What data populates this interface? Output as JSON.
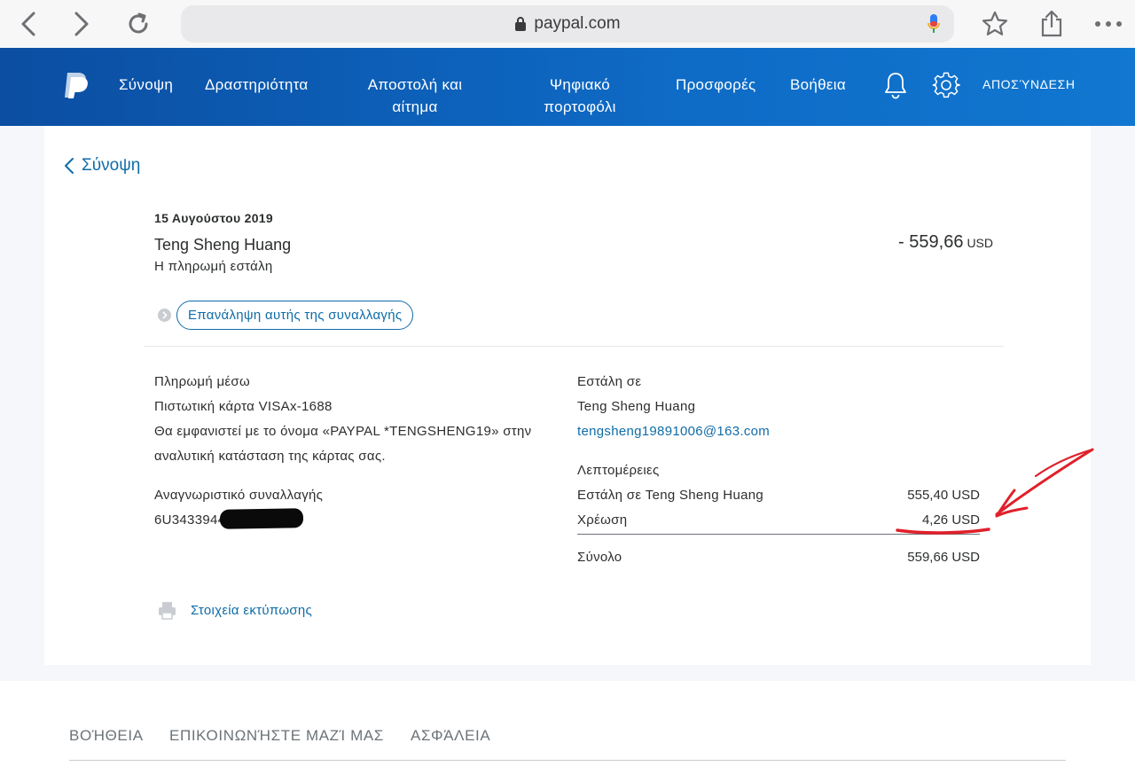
{
  "browser": {
    "url": "paypal.com"
  },
  "header": {
    "nav": [
      "Σύνοψη",
      "Δραστηριότητα",
      "Αποστολή και αίτημα",
      "Ψηφιακό πορτοφόλι",
      "Προσφορές",
      "Βοήθεια"
    ],
    "logout": "ΑΠΟΣΎΝΔΕΣΗ",
    "brand_color": "#0e6bc6"
  },
  "transaction": {
    "back_label": "Σύνοψη",
    "date": "15 Αυγούστου 2019",
    "counterparty": "Teng Sheng Huang",
    "status": "Η πληρωμή εστάλη",
    "amount": "- 559,66",
    "currency": "USD",
    "repeat_label": "Επανάληψη αυτής της συναλλαγής"
  },
  "payment": {
    "heading": "Πληρωμή μέσω",
    "card": "Πιστωτική κάρτα VISAx-1688",
    "note_line1": "Θα εμφανιστεί με το όνομα «PAYPAL *TENGSHENG19» στην",
    "note_line2": "αναλυτική κατάσταση της κάρτας σας.",
    "txn_id_heading": "Αναγνωριστικό συναλλαγής",
    "txn_id_visible": "6U3433944"
  },
  "recipient": {
    "heading": "Εστάλη σε",
    "name": "Teng Sheng Huang",
    "email": "tengsheng19891006@163.com"
  },
  "details": {
    "heading": "Λεπτομέρειες",
    "rows": [
      {
        "label": "Εστάλη σε Teng Sheng Huang",
        "value": "555,40 USD"
      },
      {
        "label": "Χρέωση",
        "value": "4,26 USD"
      }
    ],
    "total_label": "Σύνολο",
    "total_value": "559,66 USD"
  },
  "print_label": "Στοιχεία εκτύπωσης",
  "footer": {
    "links": [
      "ΒΟΉΘΕΙΑ",
      "ΕΠΙΚΟΙΝΩΝΉΣΤΕ ΜΑΖΊ ΜΑΣ",
      "ΑΣΦΆΛΕΙΑ"
    ]
  },
  "annotation_color": "#e0202a"
}
